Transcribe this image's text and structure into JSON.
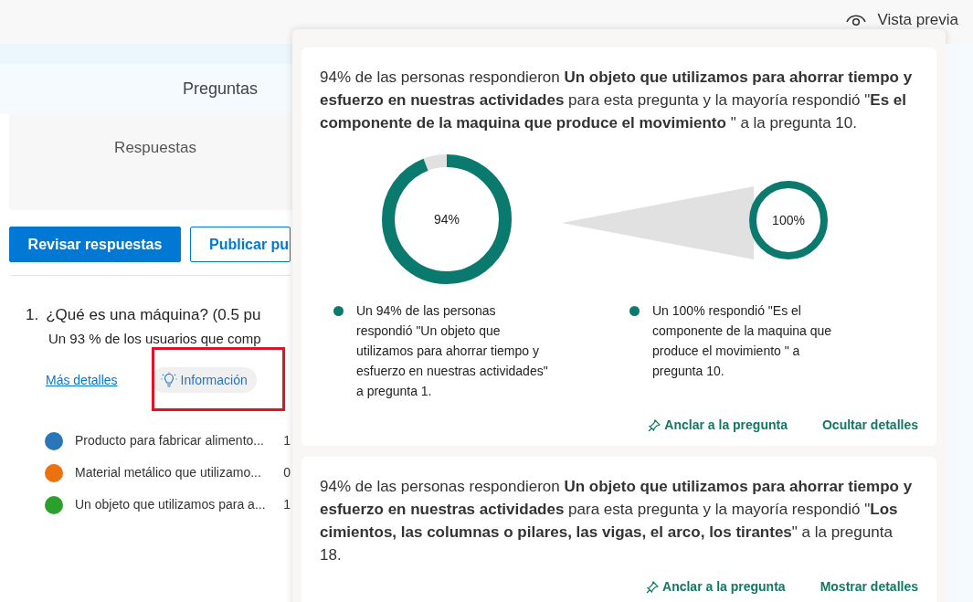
{
  "top_bar": {
    "preview": "Vista previa"
  },
  "header": {
    "tab_label": "Preguntas"
  },
  "summary": {
    "label": "Respuestas"
  },
  "buttons": [
    {
      "label": "Revisar respuestas",
      "kind": "primary"
    },
    {
      "label": "Publicar pu",
      "kind": "outline"
    }
  ],
  "question": {
    "number": "1.",
    "title": "¿Qué es una máquina? (0.5 pu",
    "summary": "Un 93 % de los usuarios que comp",
    "more_link": "Más detalles",
    "insight_button": "Información",
    "highlighted": true
  },
  "options": [
    {
      "label": "Producto para fabricar alimento...",
      "count": "1",
      "color": "#2a76b8"
    },
    {
      "label": "Material metálico que utilizamo...",
      "count": "0",
      "color": "#ec7211"
    },
    {
      "label": "Un objeto que utilizamos para a...",
      "count": "1",
      "color": "#2ca02c"
    }
  ],
  "insights": [
    {
      "text": "94% de las personas respondieron **Un objeto que utilizamos para ahorrar tiempo y esfuerzo en nuestras actividades** para esta pregunta y la mayoría respondió \"**Es el componente de la maquina que produce el movimiento** \" a la pregunta 10.",
      "expanded": true,
      "rings": [
        {
          "level": 0.94,
          "reading": "94%"
        },
        {
          "level": 1,
          "reading": "100%"
        }
      ],
      "legend": [
        "Un 94% de las personas respondió \"Un objeto que utilizamos para ahorrar tiempo y esfuerzo en nuestras actividades\" a pregunta 1.",
        "Un 100% respondió \"Es el componente de la maquina que produce el movimiento \" a pregunta 10."
      ],
      "pin": "Anclar a la pregunta",
      "toggle": "Ocultar detalles"
    },
    {
      "text": "94% de las personas respondieron **Un objeto que utilizamos para ahorrar tiempo y esfuerzo en nuestras actividades** para esta pregunta y la mayoría respondió \"**Los cimientos, las columnas o pilares, las vigas, el arco, los tirantes**\" a la pregunta 18.",
      "expanded": false,
      "pin": "Anclar a la pregunta",
      "toggle": "Mostrar detalles"
    }
  ]
}
